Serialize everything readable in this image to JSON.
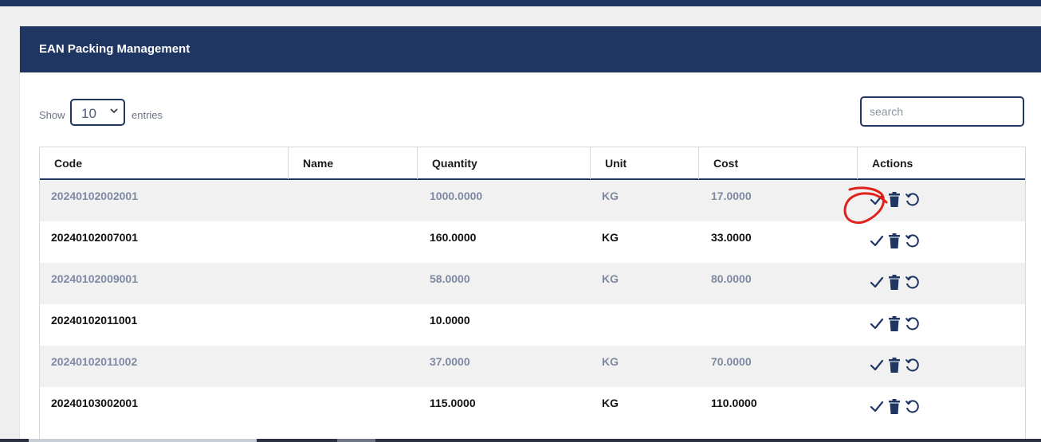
{
  "header": {
    "title": "EAN Packing Management"
  },
  "length_menu": {
    "show_label": "Show",
    "selected": "10",
    "entries_label": "entries"
  },
  "search": {
    "placeholder": "search"
  },
  "table": {
    "columns": [
      "Code",
      "Name",
      "Quantity",
      "Unit",
      "Cost",
      "Actions"
    ],
    "rows": [
      {
        "code": "20240102002001",
        "name": "",
        "quantity": "1000.0000",
        "unit": "KG",
        "cost": "17.0000"
      },
      {
        "code": "20240102007001",
        "name": "",
        "quantity": "160.0000",
        "unit": "KG",
        "cost": "33.0000"
      },
      {
        "code": "20240102009001",
        "name": "",
        "quantity": "58.0000",
        "unit": "KG",
        "cost": "80.0000"
      },
      {
        "code": "20240102011001",
        "name": "",
        "quantity": "10.0000",
        "unit": "",
        "cost": ""
      },
      {
        "code": "20240102011002",
        "name": "",
        "quantity": "37.0000",
        "unit": "KG",
        "cost": "70.0000"
      },
      {
        "code": "20240103002001",
        "name": "",
        "quantity": "115.0000",
        "unit": "KG",
        "cost": "110.0000"
      }
    ],
    "row_actions": [
      "check-icon",
      "trash-icon",
      "refresh-icon"
    ]
  },
  "annotation": {
    "color": "#e0201b",
    "target": "first-row-check-icon"
  },
  "colors": {
    "primary": "#1f3663",
    "odd_row_bg": "#f1f1f1",
    "odd_row_text": "#7f89a3"
  }
}
